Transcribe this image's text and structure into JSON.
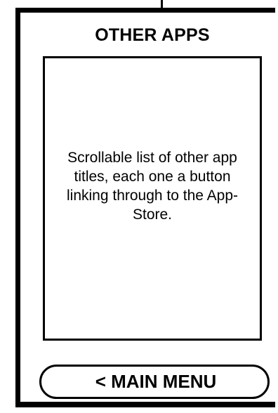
{
  "screen": {
    "title": "OTHER APPS"
  },
  "app_list": {
    "placeholder_note": "Scrollable list of other app titles, each one a button linking through to the App-Store."
  },
  "footer": {
    "main_menu_label": "< MAIN MENU"
  }
}
